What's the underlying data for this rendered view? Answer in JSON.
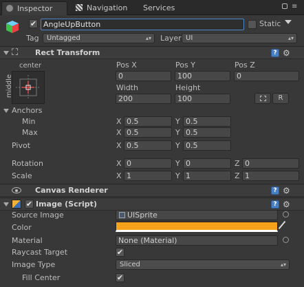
{
  "tabs": {
    "inspector": "Inspector",
    "navigation": "Navigation",
    "services": "Services"
  },
  "object": {
    "name": "AngleUpButton",
    "static_label": "Static",
    "tag_label": "Tag",
    "tag_value": "Untagged",
    "layer_label": "Layer",
    "layer_value": "UI"
  },
  "rect_transform": {
    "title": "Rect Transform",
    "anchor_h": "center",
    "anchor_v": "middle",
    "pos_x_label": "Pos X",
    "pos_y_label": "Pos Y",
    "pos_z_label": "Pos Z",
    "pos_x": "0",
    "pos_y": "100",
    "pos_z": "0",
    "width_label": "Width",
    "height_label": "Height",
    "width": "200",
    "height": "100",
    "raw_btn": "R",
    "anchors_label": "Anchors",
    "min_label": "Min",
    "max_label": "Max",
    "pivot_label": "Pivot",
    "x": "X",
    "y": "Y",
    "z": "Z",
    "min_x": "0.5",
    "min_y": "0.5",
    "max_x": "0.5",
    "max_y": "0.5",
    "pivot_x": "0.5",
    "pivot_y": "0.5",
    "rotation_label": "Rotation",
    "rot_x": "0",
    "rot_y": "0",
    "rot_z": "0",
    "scale_label": "Scale",
    "scale_x": "1",
    "scale_y": "1",
    "scale_z": "1"
  },
  "canvas_renderer": {
    "title": "Canvas Renderer"
  },
  "image": {
    "title": "Image (Script)",
    "source_label": "Source Image",
    "source_value": "UISprite",
    "color_label": "Color",
    "color_value": "#f7a21b",
    "material_label": "Material",
    "material_value": "None (Material)",
    "raycast_label": "Raycast Target",
    "type_label": "Image Type",
    "type_value": "Sliced",
    "fill_label": "Fill Center"
  }
}
